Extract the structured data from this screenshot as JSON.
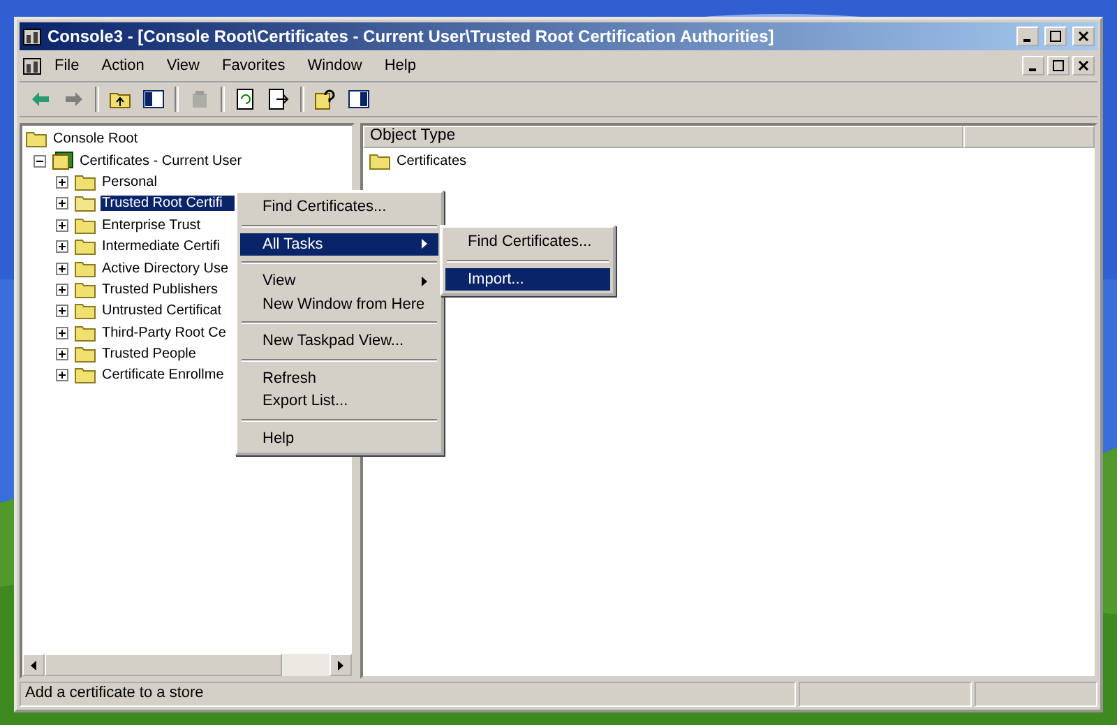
{
  "window": {
    "title": "Console3 - [Console Root\\Certificates - Current User\\Trusted Root Certification Authorities]"
  },
  "menu": [
    {
      "label": "File"
    },
    {
      "label": "Action"
    },
    {
      "label": "View"
    },
    {
      "label": "Favorites"
    },
    {
      "label": "Window"
    },
    {
      "label": "Help"
    }
  ],
  "toolbar": [
    {
      "kind": "back",
      "disabled": false
    },
    {
      "kind": "forward",
      "disabled": false
    },
    {
      "kind": "sep"
    },
    {
      "kind": "up",
      "disabled": false
    },
    {
      "kind": "tree",
      "disabled": false
    },
    {
      "kind": "sep"
    },
    {
      "kind": "delete",
      "disabled": true
    },
    {
      "kind": "sep"
    },
    {
      "kind": "refresh",
      "disabled": false
    },
    {
      "kind": "export",
      "disabled": false
    },
    {
      "kind": "sep"
    },
    {
      "kind": "help",
      "disabled": false
    },
    {
      "kind": "pane",
      "disabled": false
    }
  ],
  "tree": {
    "label": "Console Root",
    "children": [
      {
        "label": "Certificates - Current User",
        "expanded": true,
        "children": [
          {
            "label": "Personal",
            "expanded": false,
            "selected": false
          },
          {
            "label": "Trusted Root Certifi",
            "expanded": false,
            "selected": true
          },
          {
            "label": "Enterprise Trust",
            "expanded": false,
            "selected": false
          },
          {
            "label": "Intermediate Certifi",
            "expanded": false,
            "selected": false
          },
          {
            "label": "Active Directory Use",
            "expanded": false,
            "selected": false
          },
          {
            "label": "Trusted Publishers",
            "expanded": false,
            "selected": false
          },
          {
            "label": "Untrusted Certificat",
            "expanded": false,
            "selected": false
          },
          {
            "label": "Third-Party Root Ce",
            "expanded": false,
            "selected": false
          },
          {
            "label": "Trusted People",
            "expanded": false,
            "selected": false
          },
          {
            "label": "Certificate Enrollme",
            "expanded": false,
            "selected": false
          }
        ]
      }
    ]
  },
  "list": {
    "columns": [
      "Object Type"
    ],
    "rows": [
      {
        "label": "Certificates"
      }
    ]
  },
  "context_menu": {
    "items": [
      {
        "kind": "item",
        "label": "Find Certificates...",
        "selected": false,
        "submenu": false
      },
      {
        "kind": "separator"
      },
      {
        "kind": "item",
        "label": "All Tasks",
        "selected": true,
        "submenu": true
      },
      {
        "kind": "separator"
      },
      {
        "kind": "item",
        "label": "View",
        "selected": false,
        "submenu": true
      },
      {
        "kind": "item",
        "label": "New Window from Here",
        "selected": false,
        "submenu": false
      },
      {
        "kind": "separator"
      },
      {
        "kind": "item",
        "label": "New Taskpad View...",
        "selected": false,
        "submenu": false
      },
      {
        "kind": "separator"
      },
      {
        "kind": "item",
        "label": "Refresh",
        "selected": false,
        "submenu": false
      },
      {
        "kind": "item",
        "label": "Export List...",
        "selected": false,
        "submenu": false
      },
      {
        "kind": "separator"
      },
      {
        "kind": "item",
        "label": "Help",
        "selected": false,
        "submenu": false
      }
    ]
  },
  "submenu": {
    "items": [
      {
        "kind": "item",
        "label": "Find Certificates...",
        "selected": false,
        "submenu": false
      },
      {
        "kind": "separator"
      },
      {
        "kind": "item",
        "label": "Import...",
        "selected": true,
        "submenu": false
      }
    ]
  },
  "status_bar": {
    "text": "Add a certificate to a store"
  }
}
